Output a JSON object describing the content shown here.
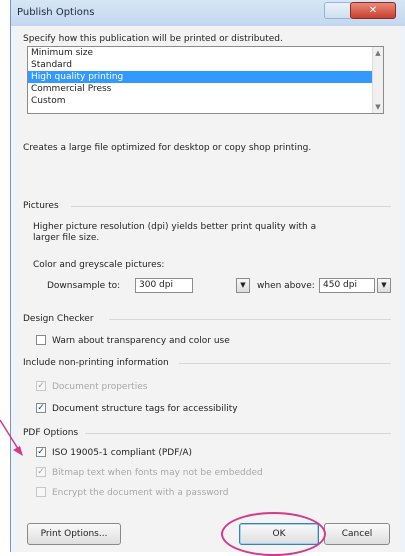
{
  "window": {
    "title": "Publish Options"
  },
  "intro": "Specify how this publication will be printed or distributed.",
  "quality_list": {
    "items": [
      "Minimum size",
      "Standard",
      "High quality printing",
      "Commercial Press",
      "Custom"
    ],
    "selected": "High quality printing"
  },
  "description": "Creates a large file optimized for desktop or copy shop printing.",
  "pictures": {
    "heading": "Pictures",
    "note_line1": "Higher picture resolution (dpi) yields better print quality with a",
    "note_line2": "larger file size.",
    "color_label": "Color and greyscale pictures:",
    "downsample_label": "Downsample to:",
    "downsample_value": "300 dpi",
    "when_above_label": "when above:",
    "when_above_value": "450 dpi"
  },
  "design_checker": {
    "heading": "Design Checker",
    "warn_label": "Warn about transparency and color use",
    "warn_checked": false
  },
  "non_printing": {
    "heading": "Include non-printing information",
    "doc_props_label": "Document properties",
    "doc_props_checked": true,
    "structure_tags_label": "Document structure tags for accessibility",
    "structure_tags_checked": true
  },
  "pdf_options": {
    "heading": "PDF Options",
    "iso_label": "ISO 19005-1 compliant (PDF/A)",
    "iso_checked": true,
    "bitmap_label": "Bitmap text when fonts may not be embedded",
    "bitmap_checked": true,
    "encrypt_label": "Encrypt the document with a password",
    "encrypt_checked": false
  },
  "buttons": {
    "print_options": "Print Options...",
    "ok": "OK",
    "cancel": "Cancel"
  },
  "annotation_colors": {
    "circle": "#d23a8c",
    "arrow": "#d23a8c"
  },
  "glyphs": {
    "check": "✓",
    "close": "✕",
    "dropdown": "▼",
    "scroll_up": "▲",
    "scroll_down": "▼"
  }
}
